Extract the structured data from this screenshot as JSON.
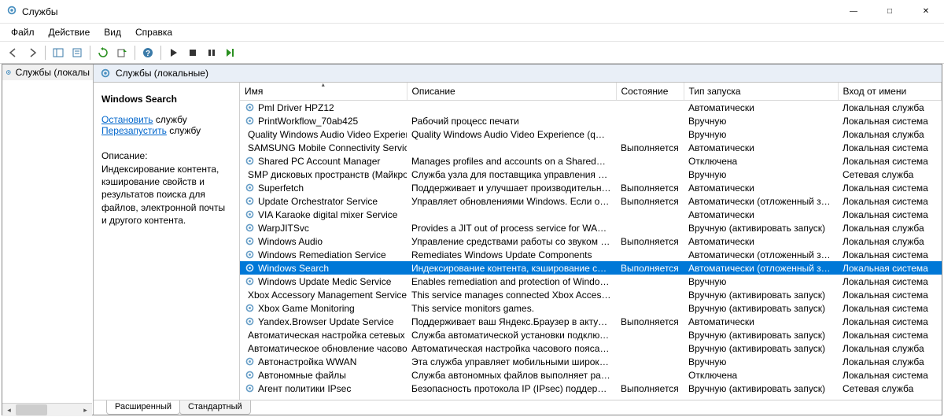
{
  "window": {
    "title": "Службы"
  },
  "menu": {
    "file": "Файл",
    "action": "Действие",
    "view": "Вид",
    "help": "Справка"
  },
  "tree": {
    "root": "Службы (локалы"
  },
  "main_header": "Службы (локальные)",
  "detail": {
    "title": "Windows Search",
    "stop_link": "Остановить",
    "stop_suffix": " службу",
    "restart_link": "Перезапустить",
    "restart_suffix": " службу",
    "desc_label": "Описание:",
    "desc_text": "Индексирование контента, кэширование свойств и результатов поиска для файлов, электронной почты и другого контента."
  },
  "columns": {
    "name": "Имя",
    "description": "Описание",
    "state": "Состояние",
    "startup": "Тип запуска",
    "logon": "Вход от имени"
  },
  "tabs": {
    "extended": "Расширенный",
    "standard": "Стандартный"
  },
  "services": [
    {
      "name": "Pml Driver HPZ12",
      "desc": "",
      "state": "",
      "start": "Автоматически",
      "logon": "Локальная служба"
    },
    {
      "name": "PrintWorkflow_70ab425",
      "desc": "Рабочий процесс печати",
      "state": "",
      "start": "Вручную",
      "logon": "Локальная система"
    },
    {
      "name": "Quality Windows Audio Video Experience",
      "desc": "Quality Windows Audio Video Experience (qWave) - с...",
      "state": "",
      "start": "Вручную",
      "logon": "Локальная служба"
    },
    {
      "name": "SAMSUNG Mobile Connectivity Service",
      "desc": "",
      "state": "Выполняется",
      "start": "Автоматически",
      "logon": "Локальная система"
    },
    {
      "name": "Shared PC Account Manager",
      "desc": "Manages profiles and accounts on a SharedPC config...",
      "state": "",
      "start": "Отключена",
      "logon": "Локальная система"
    },
    {
      "name": "SMP дисковых пространств (Майкрос...",
      "desc": "Служба узла для поставщика управления дисковы...",
      "state": "",
      "start": "Вручную",
      "logon": "Сетевая служба"
    },
    {
      "name": "Superfetch",
      "desc": "Поддерживает и улучшает производительность си...",
      "state": "Выполняется",
      "start": "Автоматически",
      "logon": "Локальная система"
    },
    {
      "name": "Update Orchestrator Service",
      "desc": "Управляет обновлениями Windows. Если она оста...",
      "state": "Выполняется",
      "start": "Автоматически (отложенный запуск)",
      "logon": "Локальная система"
    },
    {
      "name": "VIA Karaoke digital mixer Service",
      "desc": "",
      "state": "",
      "start": "Автоматически",
      "logon": "Локальная система"
    },
    {
      "name": "WarpJITSvc",
      "desc": "Provides a JIT out of process service for WARP when r...",
      "state": "",
      "start": "Вручную (активировать запуск)",
      "logon": "Локальная служба"
    },
    {
      "name": "Windows Audio",
      "desc": "Управление средствами работы со звуком для про...",
      "state": "Выполняется",
      "start": "Автоматически",
      "logon": "Локальная служба"
    },
    {
      "name": "Windows Remediation Service",
      "desc": "Remediates Windows Update Components",
      "state": "",
      "start": "Автоматически (отложенный запуск)",
      "logon": "Локальная система"
    },
    {
      "name": "Windows Search",
      "desc": "Индексирование контента, кэширование свойств ...",
      "state": "Выполняется",
      "start": "Автоматически (отложенный запуск)",
      "logon": "Локальная система",
      "selected": true
    },
    {
      "name": "Windows Update Medic Service",
      "desc": "Enables remediation and protection of Windows Upd...",
      "state": "",
      "start": "Вручную",
      "logon": "Локальная система"
    },
    {
      "name": "Xbox Accessory Management Service",
      "desc": "This service manages connected Xbox Accessories.",
      "state": "",
      "start": "Вручную (активировать запуск)",
      "logon": "Локальная система"
    },
    {
      "name": "Xbox Game Monitoring",
      "desc": "This service monitors games.",
      "state": "",
      "start": "Вручную (активировать запуск)",
      "logon": "Локальная система"
    },
    {
      "name": "Yandex.Browser Update Service",
      "desc": "Поддерживает ваш Яндекс.Браузер в актуальном с...",
      "state": "Выполняется",
      "start": "Автоматически",
      "logon": "Локальная система"
    },
    {
      "name": "Автоматическая настройка сетевых ...",
      "desc": "Служба автоматической установки подключений ...",
      "state": "",
      "start": "Вручную (активировать запуск)",
      "logon": "Локальная система"
    },
    {
      "name": "Автоматическое обновление часово...",
      "desc": "Автоматическая настройка часового пояса для си...",
      "state": "",
      "start": "Вручную (активировать запуск)",
      "logon": "Локальная служба"
    },
    {
      "name": "Автонастройка WWAN",
      "desc": "Эта служба управляет мобильными широкополос...",
      "state": "",
      "start": "Вручную",
      "logon": "Локальная служба"
    },
    {
      "name": "Автономные файлы",
      "desc": "Служба автономных файлов выполняет работу по...",
      "state": "",
      "start": "Отключена",
      "logon": "Локальная система"
    },
    {
      "name": "Агент политики IPsec",
      "desc": "Безопасность протокола IP (IPsec) поддерживает п...",
      "state": "Выполняется",
      "start": "Вручную (активировать запуск)",
      "logon": "Сетевая служба"
    }
  ]
}
